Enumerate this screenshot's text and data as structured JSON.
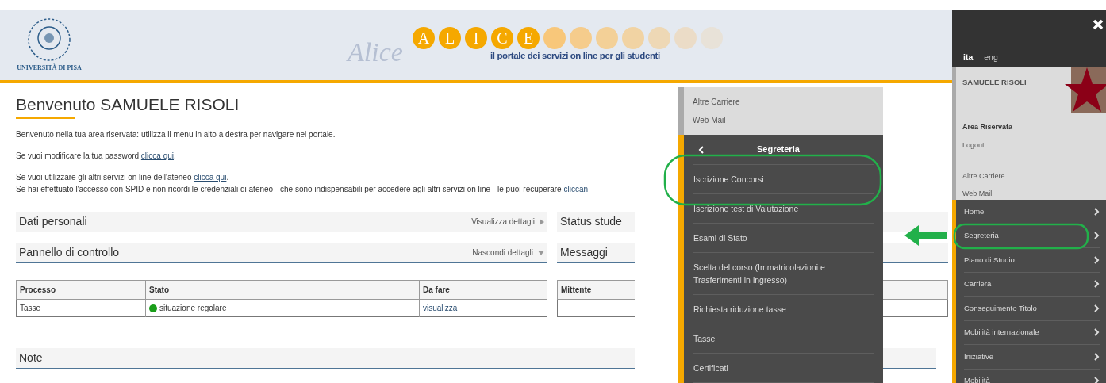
{
  "header": {
    "university": "UNIVERSITÀ DI PISA",
    "script": "Alice",
    "letters": [
      "A",
      "L",
      "I",
      "C",
      "E"
    ],
    "tagline": "il portale dei servizi on line per gli studenti"
  },
  "main": {
    "title": "Benvenuto SAMUELE RISOLI",
    "paragraph_groups": [
      [
        {
          "text": "Benvenuto nella tua area riservata: utilizza il menu in alto a destra per navigare nel portale."
        }
      ],
      [
        {
          "text": "Se vuoi modificare la tua password ",
          "link": "clicca qui",
          "after": "."
        }
      ],
      [
        {
          "text": "Se vuoi utilizzare gli altri servizi on line dell'ateneo ",
          "link": "clicca qui",
          "after": "."
        },
        {
          "text": "Se hai effettuato l'accesso con SPID e non ricordi le credenziali di ateneo - che sono indispensabili per accedere agli altri servizi on line - le puoi recuperare ",
          "link": "cliccan"
        }
      ]
    ],
    "left_panels": [
      {
        "title": "Dati personali",
        "toggle": "Visualizza dettagli",
        "expanded": false
      },
      {
        "title": "Pannello di controllo",
        "toggle": "Nascondi dettagli",
        "expanded": true
      }
    ],
    "right_panels": [
      {
        "title": "Status stude"
      },
      {
        "title": "Messaggi"
      }
    ],
    "process_table": {
      "columns": [
        "Processo",
        "Stato",
        "Da fare"
      ],
      "rows": [
        {
          "processo": "Tasse",
          "stato": "situazione regolare",
          "color": "#1a9e1a",
          "action": "visualizza"
        }
      ]
    },
    "messages_table": {
      "columns": [
        "Mittente"
      ]
    },
    "note_panel": {
      "title": "Note"
    }
  },
  "submenu": {
    "links": [
      "Altre Carriere",
      "Web Mail"
    ],
    "title": "Segreteria",
    "items": [
      "Iscrizione Concorsi",
      "Iscrizione test di Valutazione",
      "Esami di Stato",
      "Scelta del corso (Immatricolazioni e Trasferimenti in ingresso)",
      "Richiesta riduzione tasse",
      "Tasse",
      "Certificati"
    ]
  },
  "sidebar": {
    "languages": [
      {
        "label": "ita",
        "selected": true
      },
      {
        "label": "eng",
        "selected": false
      }
    ],
    "user": "SAMUELE RISOLI",
    "section": "Area Riservata",
    "logout": "Logout",
    "links": [
      "Altre Carriere",
      "Web Mail"
    ],
    "menu": [
      "Home",
      "Segreteria",
      "Piano di Studio",
      "Carriera",
      "Conseguimento Titolo",
      "Mobilità internazionale",
      "Iniziative",
      "Mobilità"
    ]
  }
}
